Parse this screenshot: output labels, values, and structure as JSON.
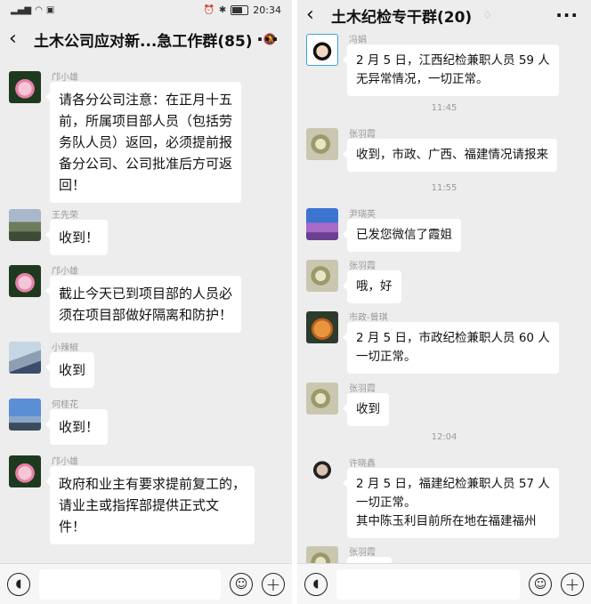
{
  "status_bar": {
    "time": "20:34",
    "battery": "68"
  },
  "left_chat": {
    "title": "土木公司应对新...急工作群(85)",
    "messages": [
      {
        "sender": "邝小雄",
        "avatar": "lotus-avatar",
        "lines": [
          "请各分公司注意：在正月十五",
          "前，所属项目部人员（包括劳",
          "务队人员）返回，必须提前报",
          "备分公司、公司批准后方可返",
          "回！"
        ]
      },
      {
        "sender": "王先荣",
        "avatar": "landscape-avatar",
        "lines": [
          "收到！"
        ]
      },
      {
        "sender": "邝小雄",
        "avatar": "lotus-avatar",
        "lines": [
          "截止今天已到项目部的人员必",
          "须在项目部做好隔离和防护！"
        ]
      },
      {
        "sender": "小辣椒",
        "avatar": "people-avatar",
        "lines": [
          "收到"
        ]
      },
      {
        "sender": "何桂花",
        "avatar": "tower-avatar",
        "lines": [
          "收到！"
        ]
      },
      {
        "sender": "邝小雄",
        "avatar": "lotus-avatar",
        "lines": [
          "政府和业主有要求提前复工的，",
          "请业主或指挥部提供正式文",
          "件！"
        ]
      }
    ]
  },
  "right_chat": {
    "title": "土木纪检专干群(20)",
    "messages": [
      {
        "sender": "冯娟",
        "avatar": "girl-avatar",
        "lines": [
          "2 月 5 日，江西纪检兼职人员 59 人",
          "无异常情况，一切正常。"
        ]
      },
      {
        "time": "11:45"
      },
      {
        "sender": "张羽霞",
        "avatar": "plant-avatar",
        "lines": [
          "收到，市政、广西、福建情况请报来"
        ]
      },
      {
        "time": "11:55"
      },
      {
        "sender": "尹瑞英",
        "avatar": "purple-avatar",
        "lines": [
          "已发您微信了霞姐"
        ]
      },
      {
        "sender": "张羽霞",
        "avatar": "plant-avatar",
        "lines": [
          "哦，好"
        ]
      },
      {
        "sender": "市政-曾琪",
        "avatar": "cat-avatar",
        "lines": [
          "2 月 5 日，市政纪检兼职人员 60 人",
          "一切正常。"
        ]
      },
      {
        "sender": "张羽霞",
        "avatar": "plant-avatar",
        "lines": [
          "收到"
        ]
      },
      {
        "time": "12:04"
      },
      {
        "sender": "许晓鑫",
        "avatar": "man-avatar",
        "lines": [
          "2 月 5 日，福建纪检兼职人员 57 人",
          "一切正常。",
          "其中陈玉利目前所在地在福建福州"
        ]
      },
      {
        "sender": "张羽霞",
        "avatar": "plant-avatar",
        "lines": []
      }
    ]
  }
}
